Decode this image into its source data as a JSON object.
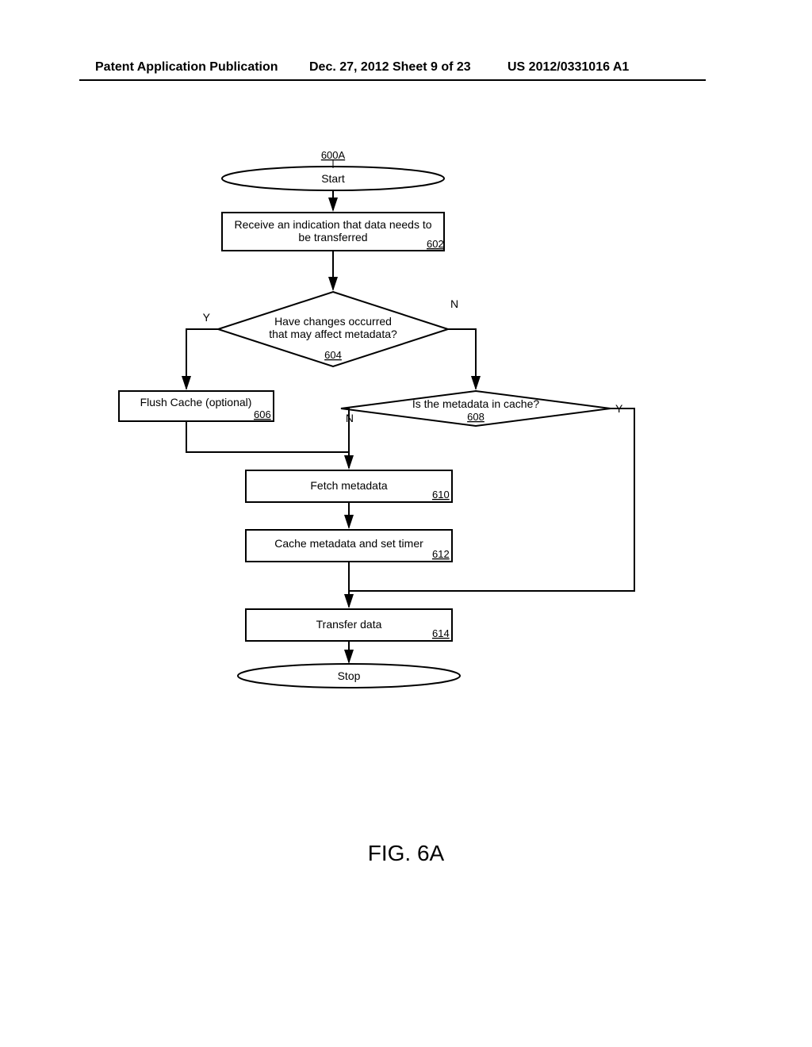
{
  "header": {
    "left": "Patent Application Publication",
    "mid": "Dec. 27, 2012  Sheet 9 of 23",
    "right": "US 2012/0331016 A1"
  },
  "figure": {
    "label": "FIG. 6A",
    "chart_ref": "600A"
  },
  "nodes": {
    "start": "Start",
    "stop": "Stop",
    "receive": {
      "line1": "Receive an indication that data needs to",
      "line2": "be transferred",
      "ref": "602"
    },
    "decision1": {
      "line1": "Have changes occurred",
      "line2": "that may affect metadata?",
      "ref": "604",
      "yes": "Y",
      "no": "N"
    },
    "flush": {
      "text": "Flush Cache (optional)",
      "ref": "606"
    },
    "decision2": {
      "text": "Is the metadata in cache?",
      "ref": "608",
      "yes": "Y",
      "no": "N"
    },
    "fetch": {
      "text": "Fetch metadata",
      "ref": "610"
    },
    "cache": {
      "text": "Cache metadata and set timer",
      "ref": "612"
    },
    "transfer": {
      "text": "Transfer data",
      "ref": "614"
    }
  }
}
